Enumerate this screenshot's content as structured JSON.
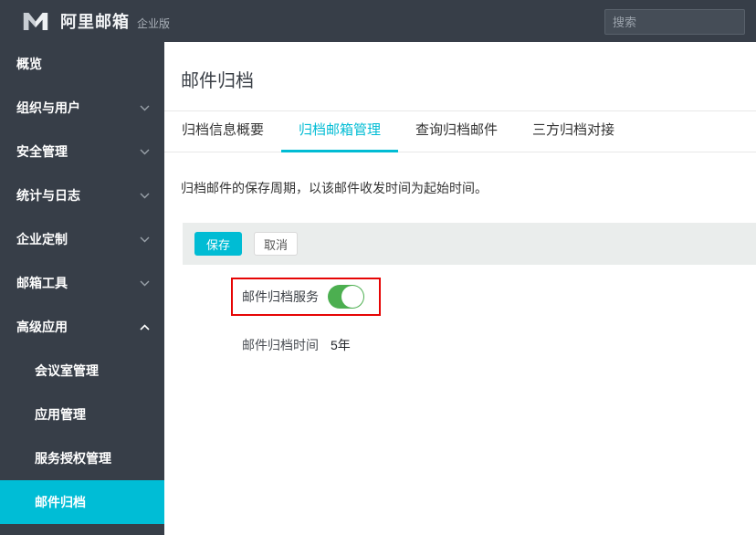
{
  "topbar": {
    "brand": "阿里邮箱",
    "brand_badge": "企业版",
    "search_placeholder": "搜索"
  },
  "sidebar": {
    "items": [
      {
        "label": "概览",
        "chevron": "none",
        "sub": false,
        "active": false
      },
      {
        "label": "组织与用户",
        "chevron": "down",
        "sub": false,
        "active": false
      },
      {
        "label": "安全管理",
        "chevron": "down",
        "sub": false,
        "active": false
      },
      {
        "label": "统计与日志",
        "chevron": "down",
        "sub": false,
        "active": false
      },
      {
        "label": "企业定制",
        "chevron": "down",
        "sub": false,
        "active": false
      },
      {
        "label": "邮箱工具",
        "chevron": "down",
        "sub": false,
        "active": false
      },
      {
        "label": "高级应用",
        "chevron": "up",
        "sub": false,
        "active": false
      },
      {
        "label": "会议室管理",
        "chevron": "none",
        "sub": true,
        "active": false
      },
      {
        "label": "应用管理",
        "chevron": "none",
        "sub": true,
        "active": false
      },
      {
        "label": "服务授权管理",
        "chevron": "none",
        "sub": true,
        "active": false
      },
      {
        "label": "邮件归档",
        "chevron": "none",
        "sub": true,
        "active": true
      }
    ]
  },
  "main": {
    "page_title": "邮件归档",
    "tabs": [
      {
        "label": "归档信息概要",
        "active": false
      },
      {
        "label": "归档邮箱管理",
        "active": true
      },
      {
        "label": "查询归档邮件",
        "active": false
      },
      {
        "label": "三方归档对接",
        "active": false
      }
    ],
    "description": "归档邮件的保存周期，以该邮件收发时间为起始时间。",
    "toolbar": {
      "save_label": "保存",
      "cancel_label": "取消"
    },
    "archive_service": {
      "label": "邮件归档服务",
      "enabled": true
    },
    "archive_time": {
      "label": "邮件归档时间",
      "value": "5年"
    }
  },
  "colors": {
    "topbar_dark": "#373e48",
    "accent_cyan": "#00bcd4",
    "sidebar_active_cyan": "#00bdd6",
    "toggle_on_green": "#4caf50",
    "annotation_red": "#e60505",
    "toolbar_gray": "#eaedec"
  }
}
